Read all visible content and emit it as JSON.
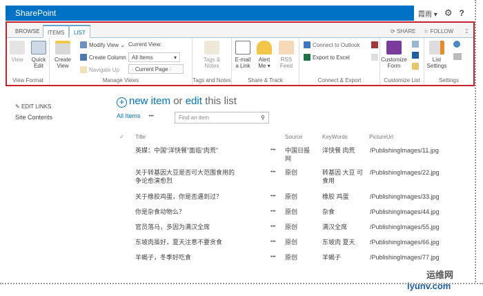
{
  "suite": {
    "title": "SharePoint",
    "user": "霞雨 ▾",
    "help": "?"
  },
  "tabs": [
    "BROWSE",
    "ITEMS",
    "LIST"
  ],
  "tab_actions": {
    "share": "SHARE",
    "follow": "FOLLOW"
  },
  "ribbon": {
    "view_format": {
      "label": "View Format",
      "view": "View",
      "quick_edit": "Quick Edit"
    },
    "manage_views": {
      "label": "Manage Views",
      "create_view": "Create View",
      "modify_view": "Modify View ⌄",
      "create_column": "Create Column",
      "navigate_up": "Navigate Up",
      "current_view_label": "Current View:",
      "current_view_value": "All Items",
      "current_page": "Current Page"
    },
    "tags": {
      "label": "Tags and Notes",
      "tags_notes": "Tags & Notes"
    },
    "share": {
      "label": "Share & Track",
      "email": "E-mail a Link",
      "alert": "Alert Me ▾",
      "rss": "RSS Feed"
    },
    "connect": {
      "label": "Connect & Export",
      "outlook": "Connect to Outlook",
      "excel": "Export to Excel"
    },
    "customize": {
      "label": "Customize List",
      "form": "Customize Form"
    },
    "settings": {
      "label": "Settings",
      "list_settings": "List Settings"
    }
  },
  "left_nav": {
    "edit_links": "EDIT LINKS",
    "site_contents": "Site Contents"
  },
  "main": {
    "new": "new item",
    "or": "or",
    "edit": "edit",
    "this_list": "this list",
    "view": "All Items",
    "more": "•••",
    "search_placeholder": "Find an item"
  },
  "columns": [
    "Title",
    "Source",
    "KeyWords",
    "PictureUrl"
  ],
  "rows": [
    {
      "title": "英媒：中国“洋快餐”面临“肉荒”",
      "source": "中国日报网",
      "keywords": "洋快餐 肉荒",
      "url": "/PublishingImages/11.jpg"
    },
    {
      "title": "关于转基因大豆是否可大范围食用的争论愈演愈烈",
      "source": "原创",
      "keywords": "转基因 大豆 可食用",
      "url": "/PublishingImages/22.jpg"
    },
    {
      "title": "关于橡胶鸡蛋，你是否遇到过？",
      "source": "原创",
      "keywords": "橡胶 鸡蛋",
      "url": "/PublishingImages/33.jpg"
    },
    {
      "title": "你是杂食动物么？",
      "source": "原创",
      "keywords": "杂食",
      "url": "/PublishingImages/44.jpg"
    },
    {
      "title": "官员落马，多因为满汉全席",
      "source": "原创",
      "keywords": "满汉全席",
      "url": "/PublishingImages/55.jpg"
    },
    {
      "title": "东坡肉虽好，夏天注意不要贪食",
      "source": "原创",
      "keywords": "东坡肉 夏天",
      "url": "/PublishingImages/66.jpg"
    },
    {
      "title": "羊蝎子，冬季好吃食",
      "source": "原创",
      "keywords": "羊蝎子",
      "url": "/PublishingImages/77.jpg"
    }
  ],
  "watermark": "运维网 iyunv.com"
}
